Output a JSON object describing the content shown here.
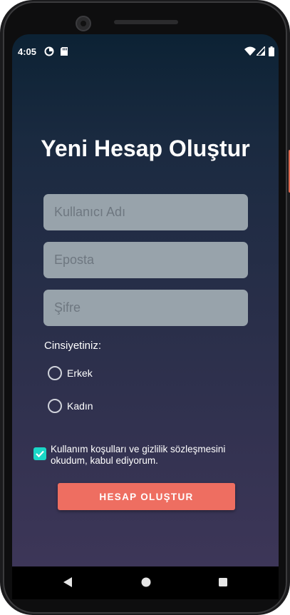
{
  "status_bar": {
    "time": "4:05"
  },
  "form": {
    "title": "Yeni Hesap Oluştur",
    "username_placeholder": "Kullanıcı Adı",
    "email_placeholder": "Eposta",
    "password_placeholder": "Şifre",
    "gender_label": "Cinsiyetiniz:",
    "gender_options": [
      {
        "label": "Erkek",
        "selected": false
      },
      {
        "label": "Kadın",
        "selected": false
      }
    ],
    "terms_text": "Kullanım koşulları ve gizlilik sözleşmesini okudum, kabul ediyorum.",
    "terms_checked": true,
    "submit_label": "HESAP OLUŞTUR"
  },
  "colors": {
    "accent_button": "#ee6e61",
    "checkbox": "#1ad7c7",
    "field_background": "#98a3ab",
    "background_top": "#0c2234",
    "background_bottom": "#3d3658"
  },
  "icons": {
    "status": [
      "data-saver-icon",
      "sd-card-icon",
      "wifi-icon",
      "signal-icon",
      "battery-icon"
    ],
    "navigation": [
      "back-icon",
      "home-icon",
      "recents-icon"
    ]
  }
}
